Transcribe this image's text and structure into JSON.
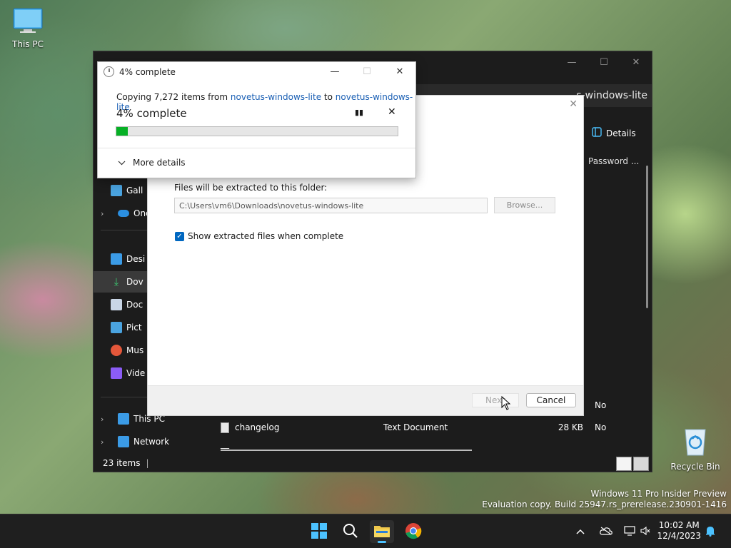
{
  "desktop": {
    "this_pc": "This PC",
    "recycle_bin": "Recycle Bin"
  },
  "explorer": {
    "tab_title_fragment_1": "",
    "tab_title": "s-windows-lite",
    "details_label": "Details",
    "column_password": "Password ...",
    "nav": {
      "gallery": "Gall",
      "onedrive": "One",
      "desktop": "Desi",
      "downloads": "Dov",
      "documents": "Doc",
      "pictures": "Pict",
      "music": "Mus",
      "videos": "Vide",
      "this_pc": "This PC",
      "network": "Network"
    },
    "rows": [
      {
        "name": "",
        "type": "",
        "size": "",
        "protected": "No"
      },
      {
        "name": "changelog",
        "type": "Text Document",
        "size": "28 KB",
        "protected": "No"
      },
      {
        "name": "__",
        "type": "",
        "size": "",
        "protected": ""
      }
    ],
    "status_items": "23 items"
  },
  "wizard": {
    "dest_label": "Files will be extracted to this folder:",
    "dest_path": "C:\\Users\\vm6\\Downloads\\novetus-windows-lite",
    "browse_label": "Browse...",
    "show_files_label": "Show extracted files when complete",
    "next_label": "Next",
    "cancel_label": "Cancel"
  },
  "progress": {
    "title": "4% complete",
    "copy_prefix": "Copying 7,272 items from ",
    "source": "novetus-windows-lite",
    "to_word": " to ",
    "dest": "novetus-windows-lite",
    "percent_text": "4% complete",
    "percent_value": 4,
    "more_details": "More details"
  },
  "watermark": {
    "line1": "Windows 11 Pro Insider Preview",
    "line2": "Evaluation copy. Build 25947.rs_prerelease.230901-1416"
  },
  "taskbar": {
    "time": "10:02 AM",
    "date": "12/4/2023"
  },
  "colors": {
    "accent": "#0067c0",
    "progress_fill": "#06b025",
    "link": "#1a5fb4"
  }
}
